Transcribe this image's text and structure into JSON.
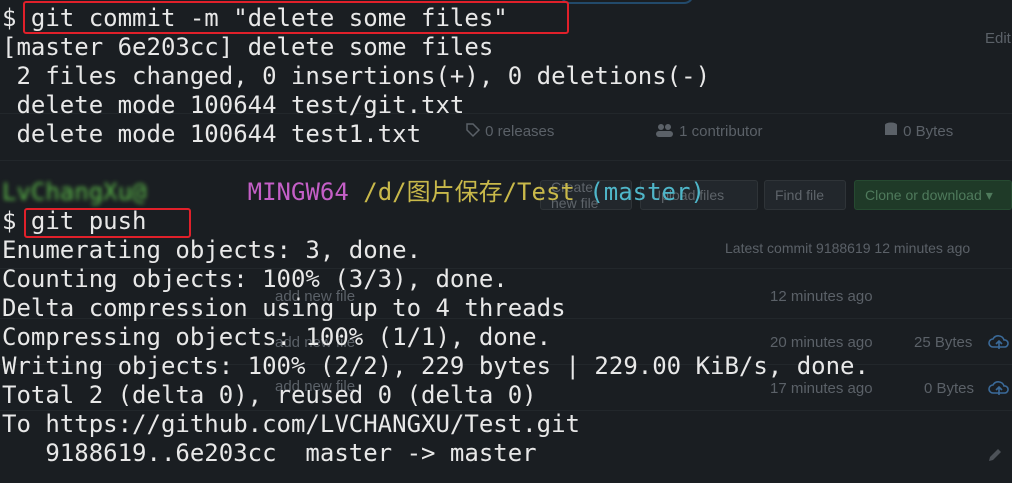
{
  "terminal": {
    "prompt_symbol": "$",
    "commit_command": "git commit -m \"delete some files\"",
    "commit_output": [
      "[master 6e203cc] delete some files",
      " 2 files changed, 0 insertions(+), 0 deletions(-)",
      " delete mode 100644 test/git.txt",
      " delete mode 100644 test1.txt"
    ],
    "prompt_line": {
      "user_host": "LvChangXu@",
      "host": "MINGW64",
      "path": "/d/图片保存/Test",
      "branch": "(master)"
    },
    "push_command": "git push",
    "push_output": [
      "Enumerating objects: 3, done.",
      "Counting objects: 100% (3/3), done.",
      "Delta compression using up to 4 threads",
      "Compressing objects: 100% (1/1), done.",
      "Writing objects: 100% (2/2), 229 bytes | 229.00 KiB/s, done.",
      "Total 2 (delta 0), reused 0 (delta 0)",
      "To https://github.com/LVCHANGXU/Test.git",
      "   9188619..6e203cc  master -> master"
    ],
    "highlight_color": "#e0202a"
  },
  "background_page": {
    "edit_label": "Edit",
    "releases": "0 releases",
    "contributors": "1 contributor",
    "size": "0 Bytes",
    "create_new_file": "Create new file",
    "upload_files": "Upload files",
    "find_file": "Find file",
    "clone_button": "Clone or download",
    "latest_commit": "Latest commit 9188619 12 minutes ago",
    "rows": [
      {
        "message": "add new file",
        "age": "12 minutes ago",
        "size": ""
      },
      {
        "message": "add new file",
        "age": "20 minutes ago",
        "size": "25 Bytes"
      },
      {
        "message": "add new file",
        "age": "17 minutes ago",
        "size": "0 Bytes"
      }
    ]
  }
}
